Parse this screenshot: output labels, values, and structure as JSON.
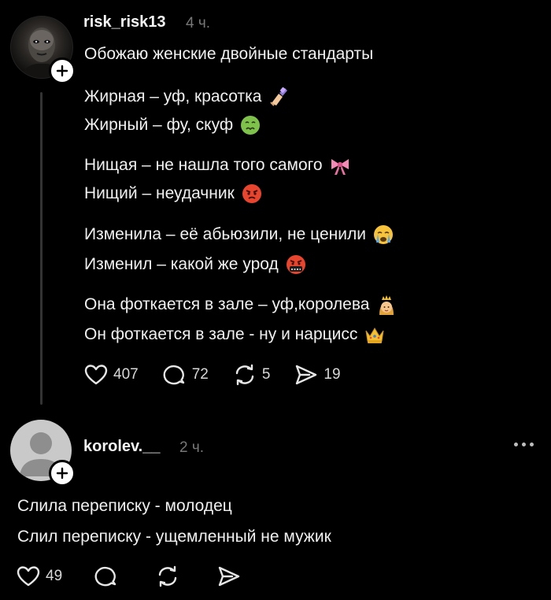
{
  "post1": {
    "username": "risk_risk13",
    "time": "4 ч.",
    "title_line": "Обожаю женские двойные стандарты",
    "lines": [
      {
        "text": "Жирная – уф, красотка",
        "emoji": "nail-polish-icon"
      },
      {
        "text": "Жирный – фу, скуф",
        "emoji": "nauseated-face-icon"
      },
      {
        "text": "Нищая – не нашла того самого",
        "emoji": "pink-bow-icon"
      },
      {
        "text": "Нищий – неудачник",
        "emoji": "angry-face-icon"
      },
      {
        "text": "Изменила – её абьюзили, не ценили",
        "emoji": "crying-face-icon"
      },
      {
        "text": "Изменил – какой же урод",
        "emoji": "cursing-face-icon"
      },
      {
        "text": "Она фоткается в зале – уф,королева",
        "emoji": "princess-icon"
      },
      {
        "text": "Он фоткается в зале - ну и нарцисс",
        "emoji": "crown-icon"
      }
    ],
    "actions": {
      "likes": "407",
      "replies": "72",
      "reposts": "5",
      "shares": "19"
    }
  },
  "post2": {
    "username": "korolev.__",
    "time": "2 ч.",
    "lines": [
      "Слила переписку - молодец",
      "Слил переписку - ущемленный не мужик"
    ],
    "actions": {
      "likes": "49"
    }
  },
  "colors": {
    "background": "#000000",
    "text": "#f0f0f0",
    "muted": "#777777",
    "thread_line": "#333333"
  }
}
